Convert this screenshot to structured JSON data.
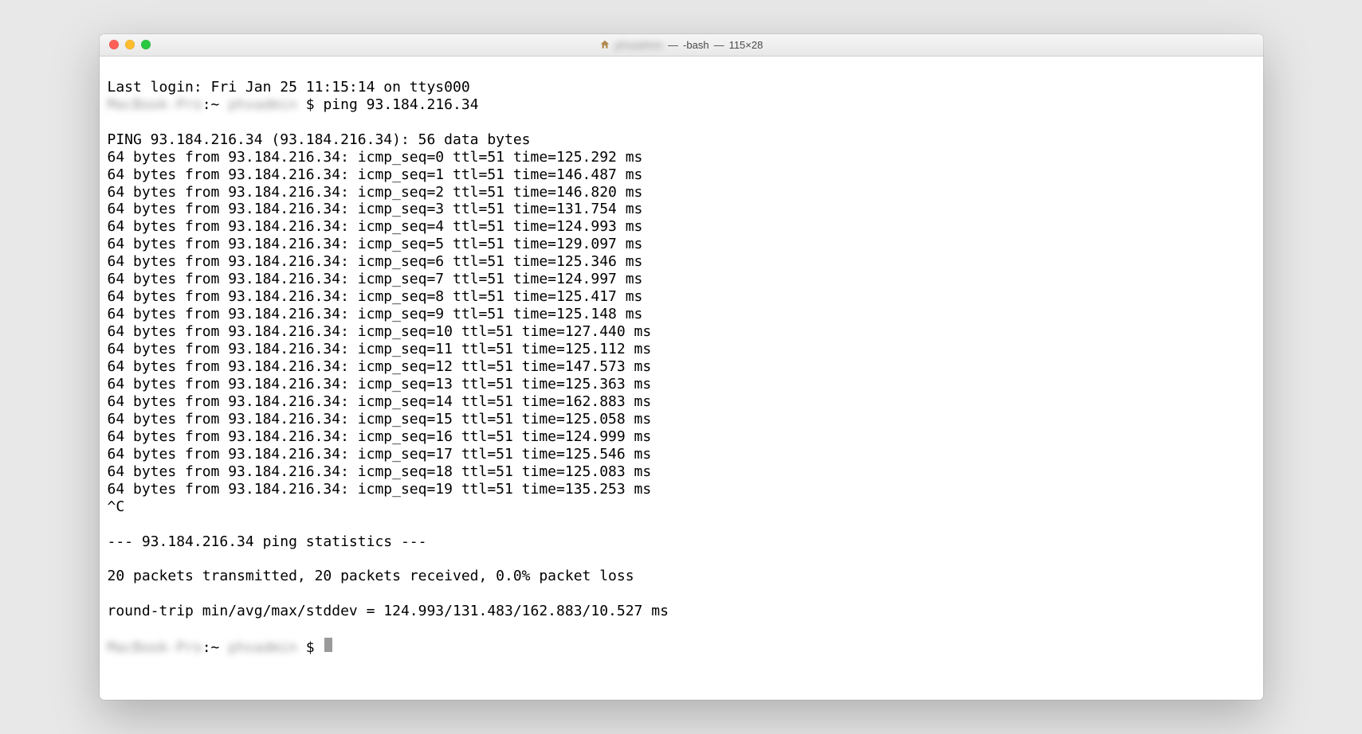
{
  "titlebar": {
    "user_blurred": "phxadmin",
    "sep1": " — ",
    "shell": "-bash",
    "sep2": " — ",
    "size": "115×28"
  },
  "last_login": "Last login: Fri Jan 25 11:15:14 on ttys000",
  "prompt1": {
    "host_blurred": "MacBook-Pro",
    "mid": ":~ ",
    "user_blurred": "phxadmin",
    "dollar": "$ ",
    "cmd": "ping 93.184.216.34"
  },
  "ping_header": "PING 93.184.216.34 (93.184.216.34): 56 data bytes",
  "replies": [
    "64 bytes from 93.184.216.34: icmp_seq=0 ttl=51 time=125.292 ms",
    "64 bytes from 93.184.216.34: icmp_seq=1 ttl=51 time=146.487 ms",
    "64 bytes from 93.184.216.34: icmp_seq=2 ttl=51 time=146.820 ms",
    "64 bytes from 93.184.216.34: icmp_seq=3 ttl=51 time=131.754 ms",
    "64 bytes from 93.184.216.34: icmp_seq=4 ttl=51 time=124.993 ms",
    "64 bytes from 93.184.216.34: icmp_seq=5 ttl=51 time=129.097 ms",
    "64 bytes from 93.184.216.34: icmp_seq=6 ttl=51 time=125.346 ms",
    "64 bytes from 93.184.216.34: icmp_seq=7 ttl=51 time=124.997 ms",
    "64 bytes from 93.184.216.34: icmp_seq=8 ttl=51 time=125.417 ms",
    "64 bytes from 93.184.216.34: icmp_seq=9 ttl=51 time=125.148 ms",
    "64 bytes from 93.184.216.34: icmp_seq=10 ttl=51 time=127.440 ms",
    "64 bytes from 93.184.216.34: icmp_seq=11 ttl=51 time=125.112 ms",
    "64 bytes from 93.184.216.34: icmp_seq=12 ttl=51 time=147.573 ms",
    "64 bytes from 93.184.216.34: icmp_seq=13 ttl=51 time=125.363 ms",
    "64 bytes from 93.184.216.34: icmp_seq=14 ttl=51 time=162.883 ms",
    "64 bytes from 93.184.216.34: icmp_seq=15 ttl=51 time=125.058 ms",
    "64 bytes from 93.184.216.34: icmp_seq=16 ttl=51 time=124.999 ms",
    "64 bytes from 93.184.216.34: icmp_seq=17 ttl=51 time=125.546 ms",
    "64 bytes from 93.184.216.34: icmp_seq=18 ttl=51 time=125.083 ms",
    "64 bytes from 93.184.216.34: icmp_seq=19 ttl=51 time=135.253 ms"
  ],
  "interrupt": "^C",
  "stats_header": "--- 93.184.216.34 ping statistics ---",
  "stats_line1": "20 packets transmitted, 20 packets received, 0.0% packet loss",
  "stats_line2": "round-trip min/avg/max/stddev = 124.993/131.483/162.883/10.527 ms",
  "prompt2": {
    "host_blurred": "MacBook-Pro",
    "mid": ":~ ",
    "user_blurred": "phxadmin",
    "dollar": "$ "
  }
}
